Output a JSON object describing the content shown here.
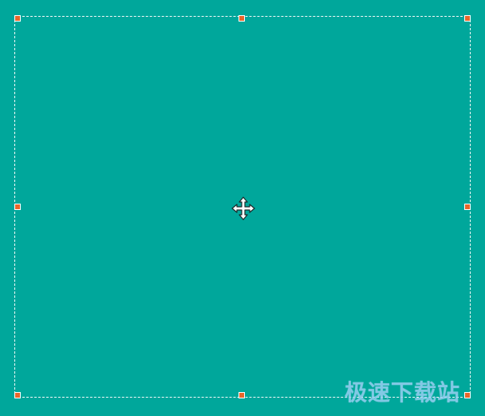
{
  "colors": {
    "background": "#00a79b",
    "selection_border": "#ffffff",
    "handle_fill": "#e8662a",
    "cursor_fill": "#ffffff",
    "cursor_stroke": "#1a2a2a"
  },
  "selection": {
    "handles": [
      "top-left",
      "top-center",
      "top-right",
      "middle-left",
      "middle-right",
      "bottom-left",
      "bottom-center",
      "bottom-right"
    ]
  },
  "cursor": {
    "icon": "move-cursor-icon"
  },
  "watermark": {
    "text": "极速下载站"
  }
}
